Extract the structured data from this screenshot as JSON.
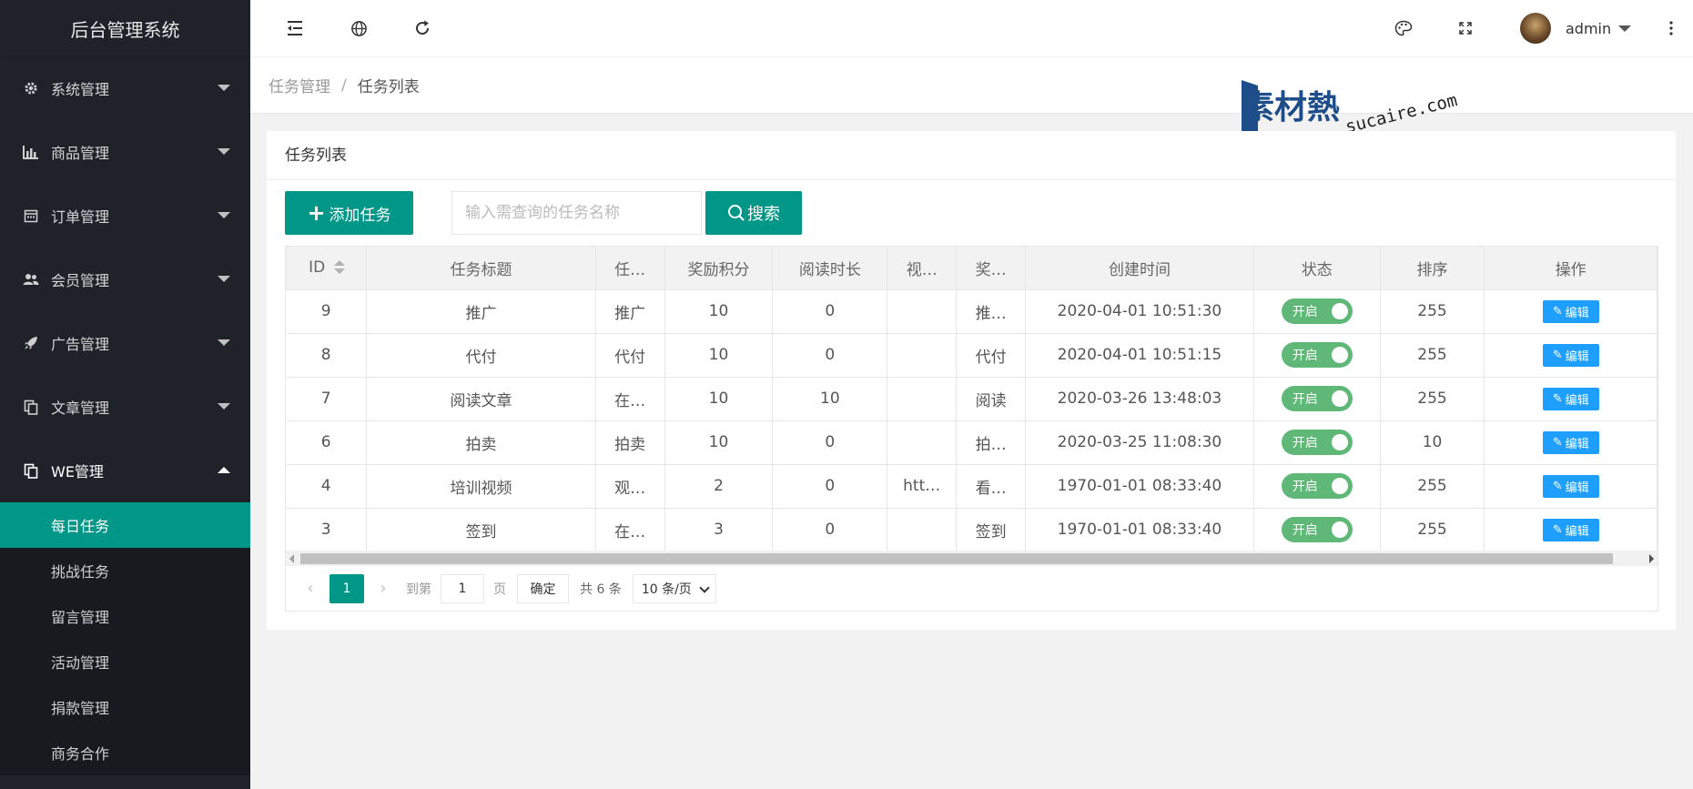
{
  "app": {
    "title": "后台管理系统"
  },
  "sidebar": {
    "items": [
      {
        "label": "系统管理",
        "icon": "gear-icon"
      },
      {
        "label": "商品管理",
        "icon": "bar-chart-icon"
      },
      {
        "label": "订单管理",
        "icon": "calendar-icon"
      },
      {
        "label": "会员管理",
        "icon": "users-icon"
      },
      {
        "label": "广告管理",
        "icon": "rocket-icon"
      },
      {
        "label": "文章管理",
        "icon": "copy-icon"
      },
      {
        "label": "WE管理",
        "icon": "copy-icon"
      }
    ],
    "subitems": [
      "每日任务",
      "挑战任务",
      "留言管理",
      "活动管理",
      "捐款管理",
      "商务合作"
    ]
  },
  "header": {
    "icons": [
      "menu-shrink-icon",
      "globe-icon",
      "refresh-icon",
      "theme-palette-icon",
      "fullscreen-icon",
      "more-vertical-icon"
    ],
    "user": "admin"
  },
  "breadcrumb": {
    "parent": "任务管理",
    "separator": "/",
    "current": "任务列表"
  },
  "watermark": {
    "cn": "素材熱",
    "en": "sucaire.com"
  },
  "card": {
    "title": "任务列表",
    "add_button": "添加任务",
    "search_placeholder": "输入需查询的任务名称",
    "search_button": "搜索"
  },
  "table": {
    "headers": [
      "ID",
      "任务标题",
      "任…",
      "奖励积分",
      "阅读时长",
      "视…",
      "奖…",
      "创建时间",
      "状态",
      "排序",
      "操作"
    ],
    "rows": [
      [
        "9",
        "推广",
        "推广",
        "10",
        "0",
        "",
        "推…",
        "2020-04-01 10:51:30",
        "开启",
        "255",
        "编辑"
      ],
      [
        "8",
        "代付",
        "代付",
        "10",
        "0",
        "",
        "代付",
        "2020-04-01 10:51:15",
        "开启",
        "255",
        "编辑"
      ],
      [
        "7",
        "阅读文章",
        "在…",
        "10",
        "10",
        "",
        "阅读",
        "2020-03-26 13:48:03",
        "开启",
        "255",
        "编辑"
      ],
      [
        "6",
        "拍卖",
        "拍卖",
        "10",
        "0",
        "",
        "拍…",
        "2020-03-25 11:08:30",
        "开启",
        "10",
        "编辑"
      ],
      [
        "4",
        "培训视频",
        "观…",
        "2",
        "0",
        "htt…",
        "看…",
        "1970-01-01 08:33:40",
        "开启",
        "255",
        "编辑"
      ],
      [
        "3",
        "签到",
        "在…",
        "3",
        "0",
        "",
        "签到",
        "1970-01-01 08:33:40",
        "开启",
        "255",
        "编辑"
      ]
    ]
  },
  "pager": {
    "current_page": "1",
    "goto_label": "到第",
    "goto_value": "1",
    "page_unit": "页",
    "confirm": "确定",
    "total": "共 6 条",
    "page_size": "10 条/页"
  },
  "colors": {
    "accent": "#009688",
    "switch_on": "#5fb878",
    "edit_button": "#1e9fff",
    "sidebar_bg": "#20222a"
  }
}
